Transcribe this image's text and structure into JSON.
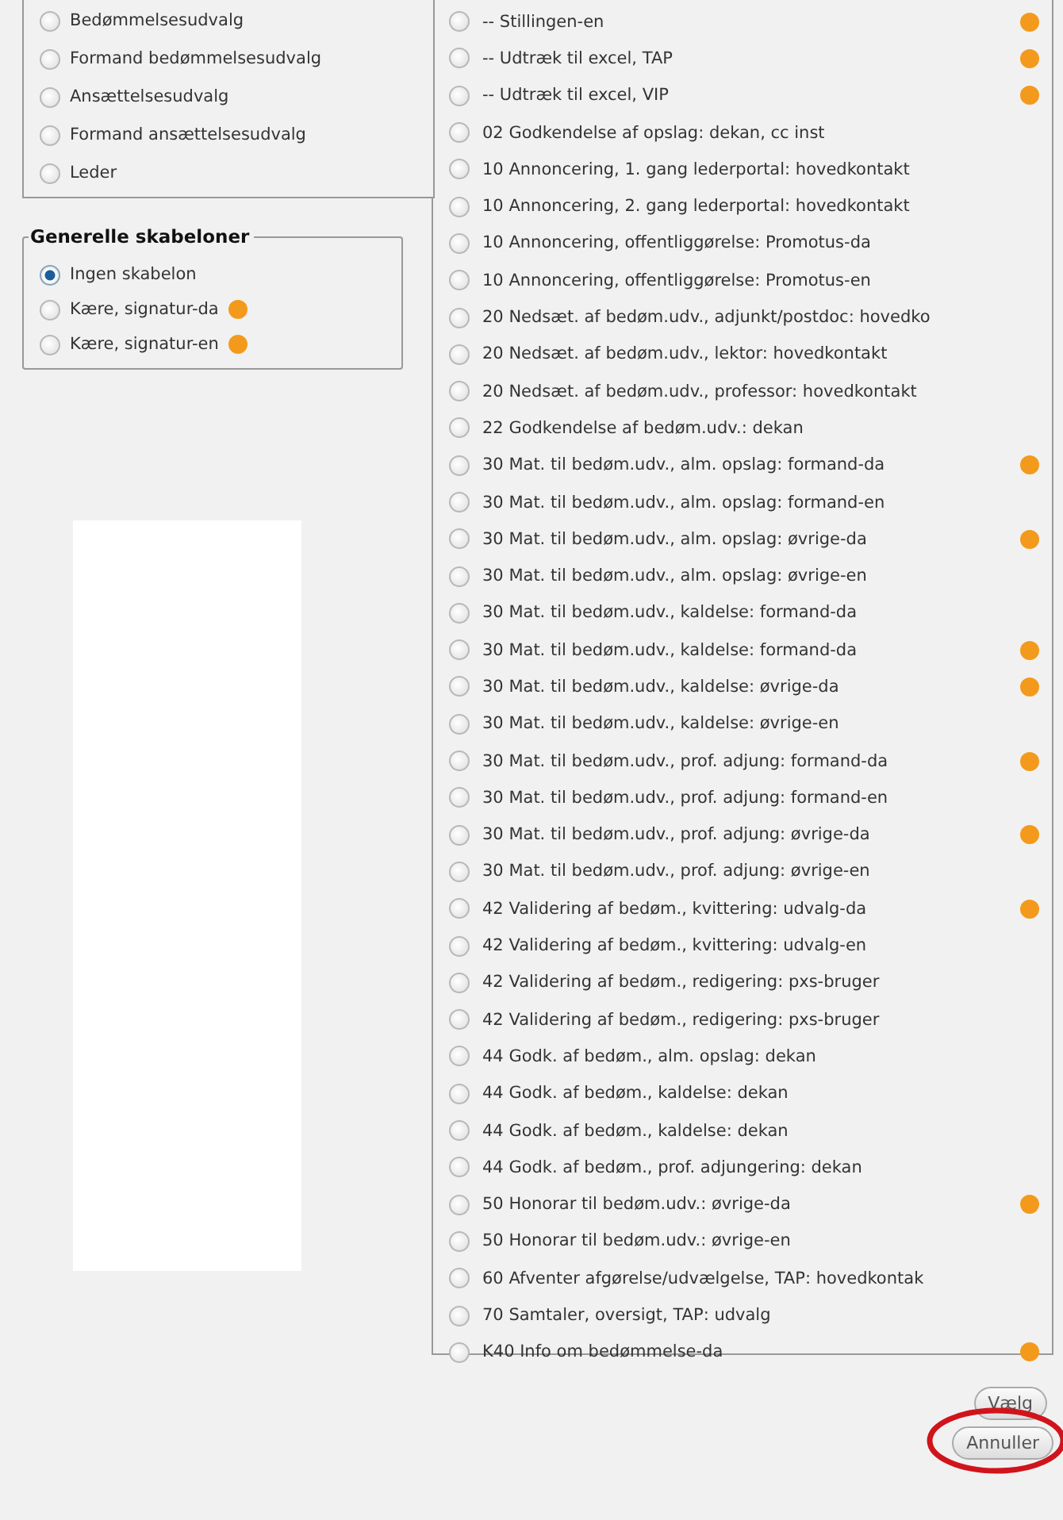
{
  "role_group": {
    "options": [
      {
        "label": "Bedømmelsesudvalg",
        "selected": false
      },
      {
        "label": "Formand bedømmelsesudvalg",
        "selected": false
      },
      {
        "label": "Ansættelsesudvalg",
        "selected": false
      },
      {
        "label": "Formand ansættelsesudvalg",
        "selected": false
      },
      {
        "label": "Leder",
        "selected": false
      }
    ]
  },
  "general_templates": {
    "legend": "Generelle skabeloner",
    "options": [
      {
        "label": "Ingen skabelon",
        "selected": true,
        "help": false
      },
      {
        "label": "Kære, signatur-da",
        "selected": false,
        "help": true
      },
      {
        "label": "Kære, signatur-en",
        "selected": false,
        "help": true
      }
    ]
  },
  "templates": [
    {
      "label": "-- Stillingen-en",
      "selected": false,
      "help": true
    },
    {
      "label": "-- Udtræk til excel, TAP",
      "selected": false,
      "help": true
    },
    {
      "label": "-- Udtræk til excel, VIP",
      "selected": false,
      "help": true
    },
    {
      "label": "02 Godkendelse af opslag: dekan, cc inst",
      "selected": false,
      "help": false
    },
    {
      "label": "10 Annoncering, 1. gang lederportal: hovedkontakt",
      "selected": false,
      "help": false
    },
    {
      "label": "10 Annoncering, 2. gang lederportal: hovedkontakt",
      "selected": false,
      "help": false
    },
    {
      "label": "10 Annoncering, offentliggørelse: Promotus-da",
      "selected": false,
      "help": false
    },
    {
      "label": "10 Annoncering, offentliggørelse: Promotus-en",
      "selected": false,
      "help": false
    },
    {
      "label": "20 Nedsæt. af bedøm.udv., adjunkt/postdoc: hovedko",
      "selected": false,
      "help": false
    },
    {
      "label": "20 Nedsæt. af bedøm.udv., lektor: hovedkontakt",
      "selected": false,
      "help": false
    },
    {
      "label": "20 Nedsæt. af bedøm.udv., professor: hovedkontakt",
      "selected": false,
      "help": false
    },
    {
      "label": "22 Godkendelse af bedøm.udv.: dekan",
      "selected": false,
      "help": false
    },
    {
      "label": "30 Mat. til bedøm.udv., alm. opslag: formand-da",
      "selected": false,
      "help": true
    },
    {
      "label": "30 Mat. til bedøm.udv., alm. opslag: formand-en",
      "selected": false,
      "help": false
    },
    {
      "label": "30 Mat. til bedøm.udv., alm. opslag: øvrige-da",
      "selected": false,
      "help": true
    },
    {
      "label": "30 Mat. til bedøm.udv., alm. opslag: øvrige-en",
      "selected": false,
      "help": false
    },
    {
      "label": "30 Mat. til bedøm.udv., kaldelse: formand-da",
      "selected": false,
      "help": false
    },
    {
      "label": "30 Mat. til bedøm.udv., kaldelse: formand-da",
      "selected": false,
      "help": true
    },
    {
      "label": "30 Mat. til bedøm.udv., kaldelse: øvrige-da",
      "selected": false,
      "help": true
    },
    {
      "label": "30 Mat. til bedøm.udv., kaldelse: øvrige-en",
      "selected": false,
      "help": false
    },
    {
      "label": "30 Mat. til bedøm.udv., prof. adjung: formand-da",
      "selected": false,
      "help": true
    },
    {
      "label": "30 Mat. til bedøm.udv., prof. adjung: formand-en",
      "selected": false,
      "help": false
    },
    {
      "label": "30 Mat. til bedøm.udv., prof. adjung: øvrige-da",
      "selected": false,
      "help": true
    },
    {
      "label": "30 Mat. til bedøm.udv., prof. adjung: øvrige-en",
      "selected": false,
      "help": false
    },
    {
      "label": "42 Validering af bedøm., kvittering: udvalg-da",
      "selected": false,
      "help": true
    },
    {
      "label": "42 Validering af bedøm., kvittering: udvalg-en",
      "selected": false,
      "help": false
    },
    {
      "label": "42 Validering af bedøm., redigering: pxs-bruger",
      "selected": false,
      "help": false
    },
    {
      "label": "42 Validering af bedøm., redigering: pxs-bruger",
      "selected": false,
      "help": false
    },
    {
      "label": "44 Godk. af bedøm., alm. opslag: dekan",
      "selected": false,
      "help": false
    },
    {
      "label": "44 Godk. af bedøm., kaldelse: dekan",
      "selected": false,
      "help": false
    },
    {
      "label": "44 Godk. af bedøm., kaldelse: dekan",
      "selected": false,
      "help": false
    },
    {
      "label": "44 Godk. af bedøm., prof. adjungering: dekan",
      "selected": false,
      "help": false
    },
    {
      "label": "50 Honorar til bedøm.udv.: øvrige-da",
      "selected": false,
      "help": true
    },
    {
      "label": "50 Honorar til bedøm.udv.: øvrige-en",
      "selected": false,
      "help": false
    },
    {
      "label": "60 Afventer afgørelse/udvælgelse, TAP: hovedkontak",
      "selected": false,
      "help": false
    },
    {
      "label": "70 Samtaler, oversigt, TAP: udvalg",
      "selected": false,
      "help": false
    },
    {
      "label": "K40 Info om bedømmelse-da",
      "selected": false,
      "help": true
    }
  ],
  "buttons": [
    {
      "label": "Vælg"
    },
    {
      "label": "Annuller",
      "highlighted": true
    }
  ]
}
